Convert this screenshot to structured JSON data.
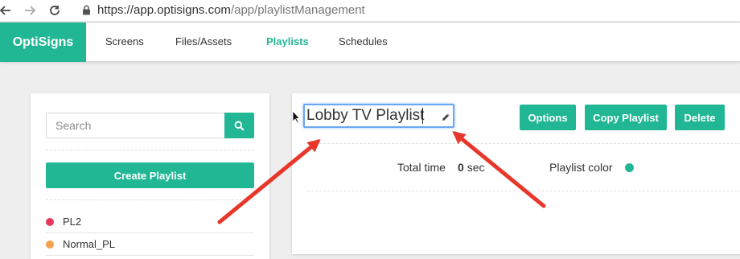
{
  "browser": {
    "url_host": "https://app.optisigns.com",
    "url_path": "/app/playlistManagement"
  },
  "navbar": {
    "brand": "OptiSigns",
    "links": [
      {
        "label": "Screens",
        "active": false
      },
      {
        "label": "Files/Assets",
        "active": false
      },
      {
        "label": "Playlists",
        "active": true
      },
      {
        "label": "Schedules",
        "active": false
      }
    ]
  },
  "sidebar": {
    "search_placeholder": "Search",
    "create_label": "Create Playlist",
    "playlists": [
      {
        "name": "PL2",
        "color": "#e8375a"
      },
      {
        "name": "Normal_PL",
        "color": "#f5a04a"
      }
    ]
  },
  "editor": {
    "title_value": "Lobby TV Playlist",
    "buttons": {
      "options": "Options",
      "copy": "Copy Playlist",
      "delete": "Delete"
    },
    "total_time_label": "Total time",
    "total_time_value": "0",
    "total_time_unit": "sec",
    "color_label": "Playlist color",
    "color_value": "#22b794"
  },
  "colors": {
    "accent": "#22b794",
    "annotation_arrow": "#e8372a",
    "focus_ring": "#6aa8ef"
  },
  "icons": [
    "back-arrow-icon",
    "forward-arrow-icon",
    "reload-icon",
    "lock-icon",
    "search-icon",
    "pencil-icon",
    "cursor-icon"
  ]
}
